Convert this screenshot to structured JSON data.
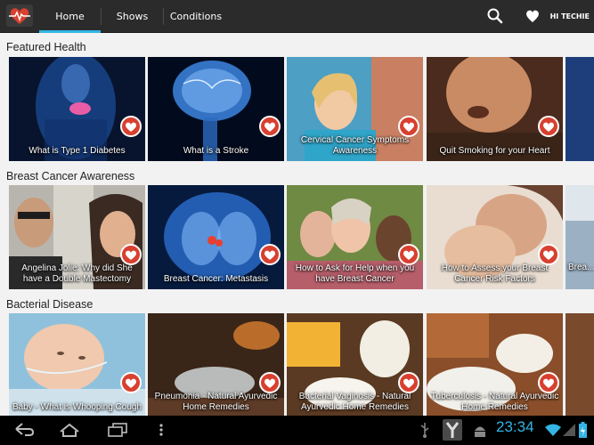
{
  "app": {
    "tabs": [
      {
        "label": "Home",
        "active": true
      },
      {
        "label": "Shows",
        "active": false
      },
      {
        "label": "Conditions",
        "active": false
      }
    ],
    "user_label": "HI TECHIE",
    "icons": {
      "logo": "heart-pulse-logo",
      "search": "search-icon",
      "favorites": "heart-icon"
    },
    "accent_color": "#33b5e5"
  },
  "sections": [
    {
      "title": "Featured Health",
      "cards": [
        {
          "caption": "What is Type 1 Diabetes"
        },
        {
          "caption": "What is a Stroke"
        },
        {
          "caption": "Cervical Cancer Symptoms Awareness"
        },
        {
          "caption": "Quit Smoking for your Heart"
        }
      ]
    },
    {
      "title": "Breast Cancer Awareness",
      "cards": [
        {
          "caption": "Angelina Jolie: Why did She have a Double Mastectomy"
        },
        {
          "caption": "Breast Cancer: Metastasis"
        },
        {
          "caption": "How to Ask for Help when you have Breast Cancer"
        },
        {
          "caption": "How to Assess your Breast Cancer Risk Factors"
        },
        {
          "caption": "Brea..."
        }
      ]
    },
    {
      "title": "Bacterial Disease",
      "cards": [
        {
          "caption": "Baby - What is Whooping Cough"
        },
        {
          "caption": "Pneumonia - Natural Ayurvedic Home Remedies"
        },
        {
          "caption": "Bacterial Vaginosis - Natural Ayurvedic Home Remedies"
        },
        {
          "caption": "Tuberculosis - Natural Ayurvedic Home Remedies"
        }
      ]
    }
  ],
  "system": {
    "clock": "23:34",
    "nav_icons": [
      "back-icon",
      "home-icon",
      "recent-apps-icon",
      "menu-icon"
    ],
    "status_icons": [
      "usb-icon",
      "y-app-icon",
      "android-debug-icon",
      "wifi-icon",
      "signal-icon",
      "battery-icon"
    ]
  }
}
